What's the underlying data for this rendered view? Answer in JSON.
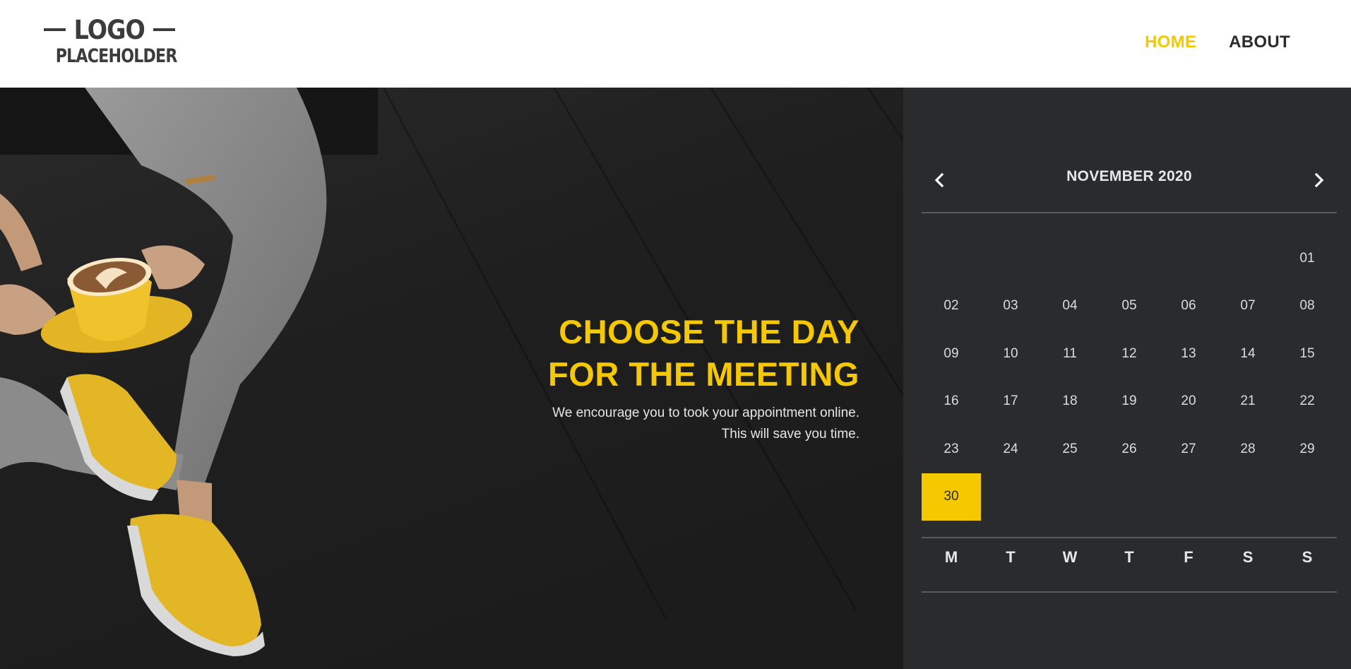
{
  "logo": {
    "top_word": "LOGO",
    "bottom_word": "PLACEHOLDER"
  },
  "nav": {
    "home": "HOME",
    "about": "ABOUT"
  },
  "hero": {
    "title_line1": "CHOOSE THE DAY",
    "title_line2": "FOR THE MEETING",
    "subtitle_line1": "We encourage you to took your appointment online.",
    "subtitle_line2": "This will save you time."
  },
  "calendar": {
    "month_label": "NOVEMBER 2020",
    "prev_icon": "chevron-left-icon",
    "next_icon": "chevron-right-icon",
    "leading_blanks": 6,
    "days": [
      "01",
      "02",
      "03",
      "04",
      "05",
      "06",
      "07",
      "08",
      "09",
      "10",
      "11",
      "12",
      "13",
      "14",
      "15",
      "16",
      "17",
      "18",
      "19",
      "20",
      "21",
      "22",
      "23",
      "24",
      "25",
      "26",
      "27",
      "28",
      "29",
      "30"
    ],
    "selected_day": "30",
    "weekdays": [
      "M",
      "T",
      "W",
      "T",
      "F",
      "S",
      "S"
    ]
  },
  "colors": {
    "accent": "#f5c800",
    "panel": "#2a2b2d",
    "header_bg": "#ffffff",
    "nav_text": "#2b2b2b"
  }
}
